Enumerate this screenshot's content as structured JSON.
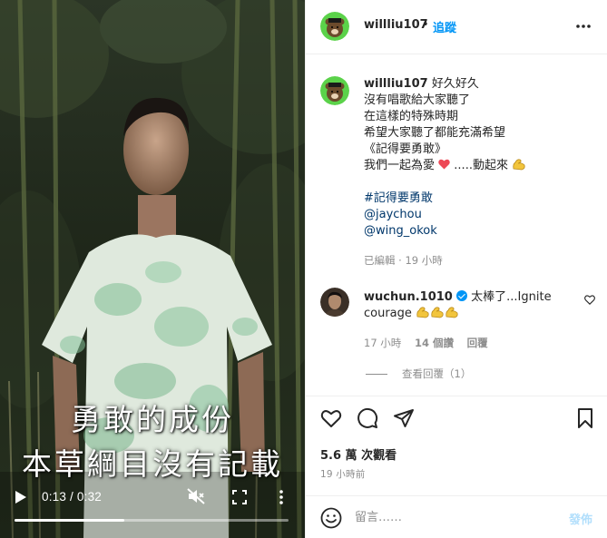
{
  "video": {
    "subtitle_line1": "勇敢的成份",
    "subtitle_line2": "本草綱目沒有記載",
    "time": "0:13 / 0:32",
    "progress": 0.4
  },
  "header": {
    "username": "willliu107",
    "separator": "•",
    "follow_label": "追蹤"
  },
  "caption": {
    "username": "willliu107",
    "lines": [
      "好久好久",
      "沒有唱歌給大家聽了",
      "在這樣的特殊時期",
      "希望大家聽了都能充滿希望",
      "《記得要勇敢》",
      "我們一起為愛",
      ".....動起來"
    ],
    "hashtag": "#記得要勇敢",
    "mention1": "@jaychou",
    "mention2": "@wing_okok",
    "meta": "已編輯 · 19 小時"
  },
  "comment": {
    "username": "wuchun.1010",
    "text": "太棒了...Ignite courage",
    "time": "17 小時",
    "likes": "14 個讚",
    "reply_label": "回覆",
    "view_replies": "查看回覆（1）"
  },
  "post": {
    "views": "5.6 萬 次觀看",
    "ago": "19 小時前"
  },
  "comment_box": {
    "placeholder": "留言……",
    "post_label": "發佈"
  },
  "colors": {
    "accent": "#0095f6",
    "link": "#00376b",
    "muted": "#8e8e8e",
    "heart": "#ed4956"
  }
}
